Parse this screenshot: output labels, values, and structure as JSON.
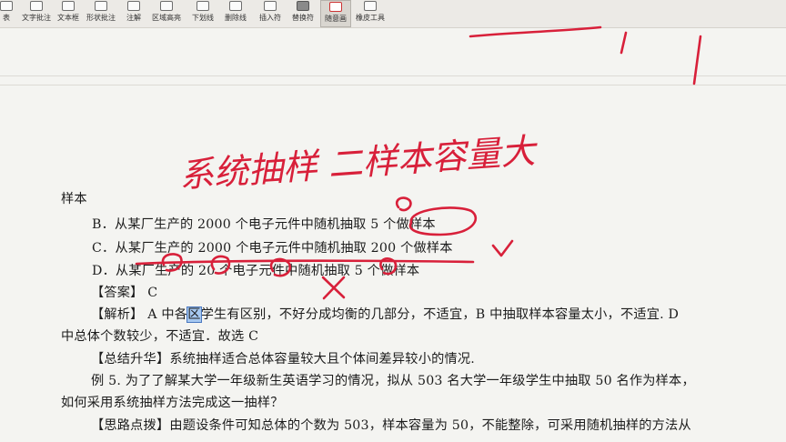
{
  "toolbar": {
    "items": [
      {
        "label": "表",
        "icon": "insert-icon"
      },
      {
        "label": "文字批注",
        "icon": "text-comment-icon"
      },
      {
        "label": "文本框",
        "icon": "textbox-icon"
      },
      {
        "label": "形状批注",
        "icon": "shape-comment-icon"
      },
      {
        "label": "注解",
        "icon": "annotation-icon"
      },
      {
        "label": "区域高亮",
        "icon": "area-highlight-icon"
      },
      {
        "label": "下划线",
        "icon": "underline-icon"
      },
      {
        "label": "删除线",
        "icon": "strikethrough-icon"
      },
      {
        "label": "插入符",
        "icon": "caret-icon"
      },
      {
        "label": "替换符",
        "icon": "replace-icon"
      },
      {
        "label": "随意画",
        "icon": "freehand-pen-icon"
      },
      {
        "label": "橡皮工具",
        "icon": "eraser-icon"
      }
    ],
    "active_item": "随意画"
  },
  "document": {
    "handwritten_note": "系统抽样 二样本容量大",
    "lines": {
      "sample": "样本",
      "option_b": "B．从某厂生产的 2000 个电子元件中随机抽取 5 个做样本",
      "option_c": "C．从某厂生产的 2000 个电子元件中随机抽取 200 个做样本",
      "option_d": "D．从某厂生产的 20 个电子元件中随机抽取 5 个做样本",
      "answer": "【答案】 C",
      "analysis_pre": "【解析】 A 中各",
      "analysis_hl": "区",
      "analysis_post": "学生有区别，不好分成均衡的几部分，不适宜，B 中抽取样本容量太小，不适宜. D",
      "analysis_2": "中总体个数较少，不适宜．故选 C",
      "summary": "【总结升华】系统抽样适合总体容量较大且个体间差异较小的情况.",
      "example_1": "例 5. 为了了解某大学一年级新生英语学习的情况，拟从 503 名大学一年级学生中抽取 50 名作为样本，",
      "example_2": "如何采用系统抽样方法完成这一抽样？",
      "hint": "【思路点拨】由题设条件可知总体的个数为 503，样本容量为 50，不能整除，可采用随机抽样的方法从"
    }
  },
  "colors": {
    "ink": "#d8203a",
    "highlight": "#a6c8f0"
  }
}
